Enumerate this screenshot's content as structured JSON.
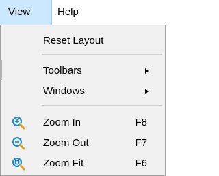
{
  "menubar": {
    "items": [
      {
        "label": "View"
      },
      {
        "label": "Help"
      }
    ]
  },
  "view_menu": {
    "items": [
      {
        "label": "Reset Layout"
      },
      {
        "label": "Toolbars",
        "submenu": true
      },
      {
        "label": "Windows",
        "submenu": true
      },
      {
        "label": "Zoom In",
        "shortcut": "F8",
        "icon": "zoom-in-icon"
      },
      {
        "label": "Zoom Out",
        "shortcut": "F7",
        "icon": "zoom-out-icon"
      },
      {
        "label": "Zoom Fit",
        "shortcut": "F6",
        "icon": "zoom-fit-icon"
      }
    ]
  },
  "colors": {
    "menubar_selected_bg": "#cce8ff",
    "menu_bg": "#f0f0f0",
    "icon_glass": "#1c86c7",
    "icon_handle": "#e0a020"
  }
}
